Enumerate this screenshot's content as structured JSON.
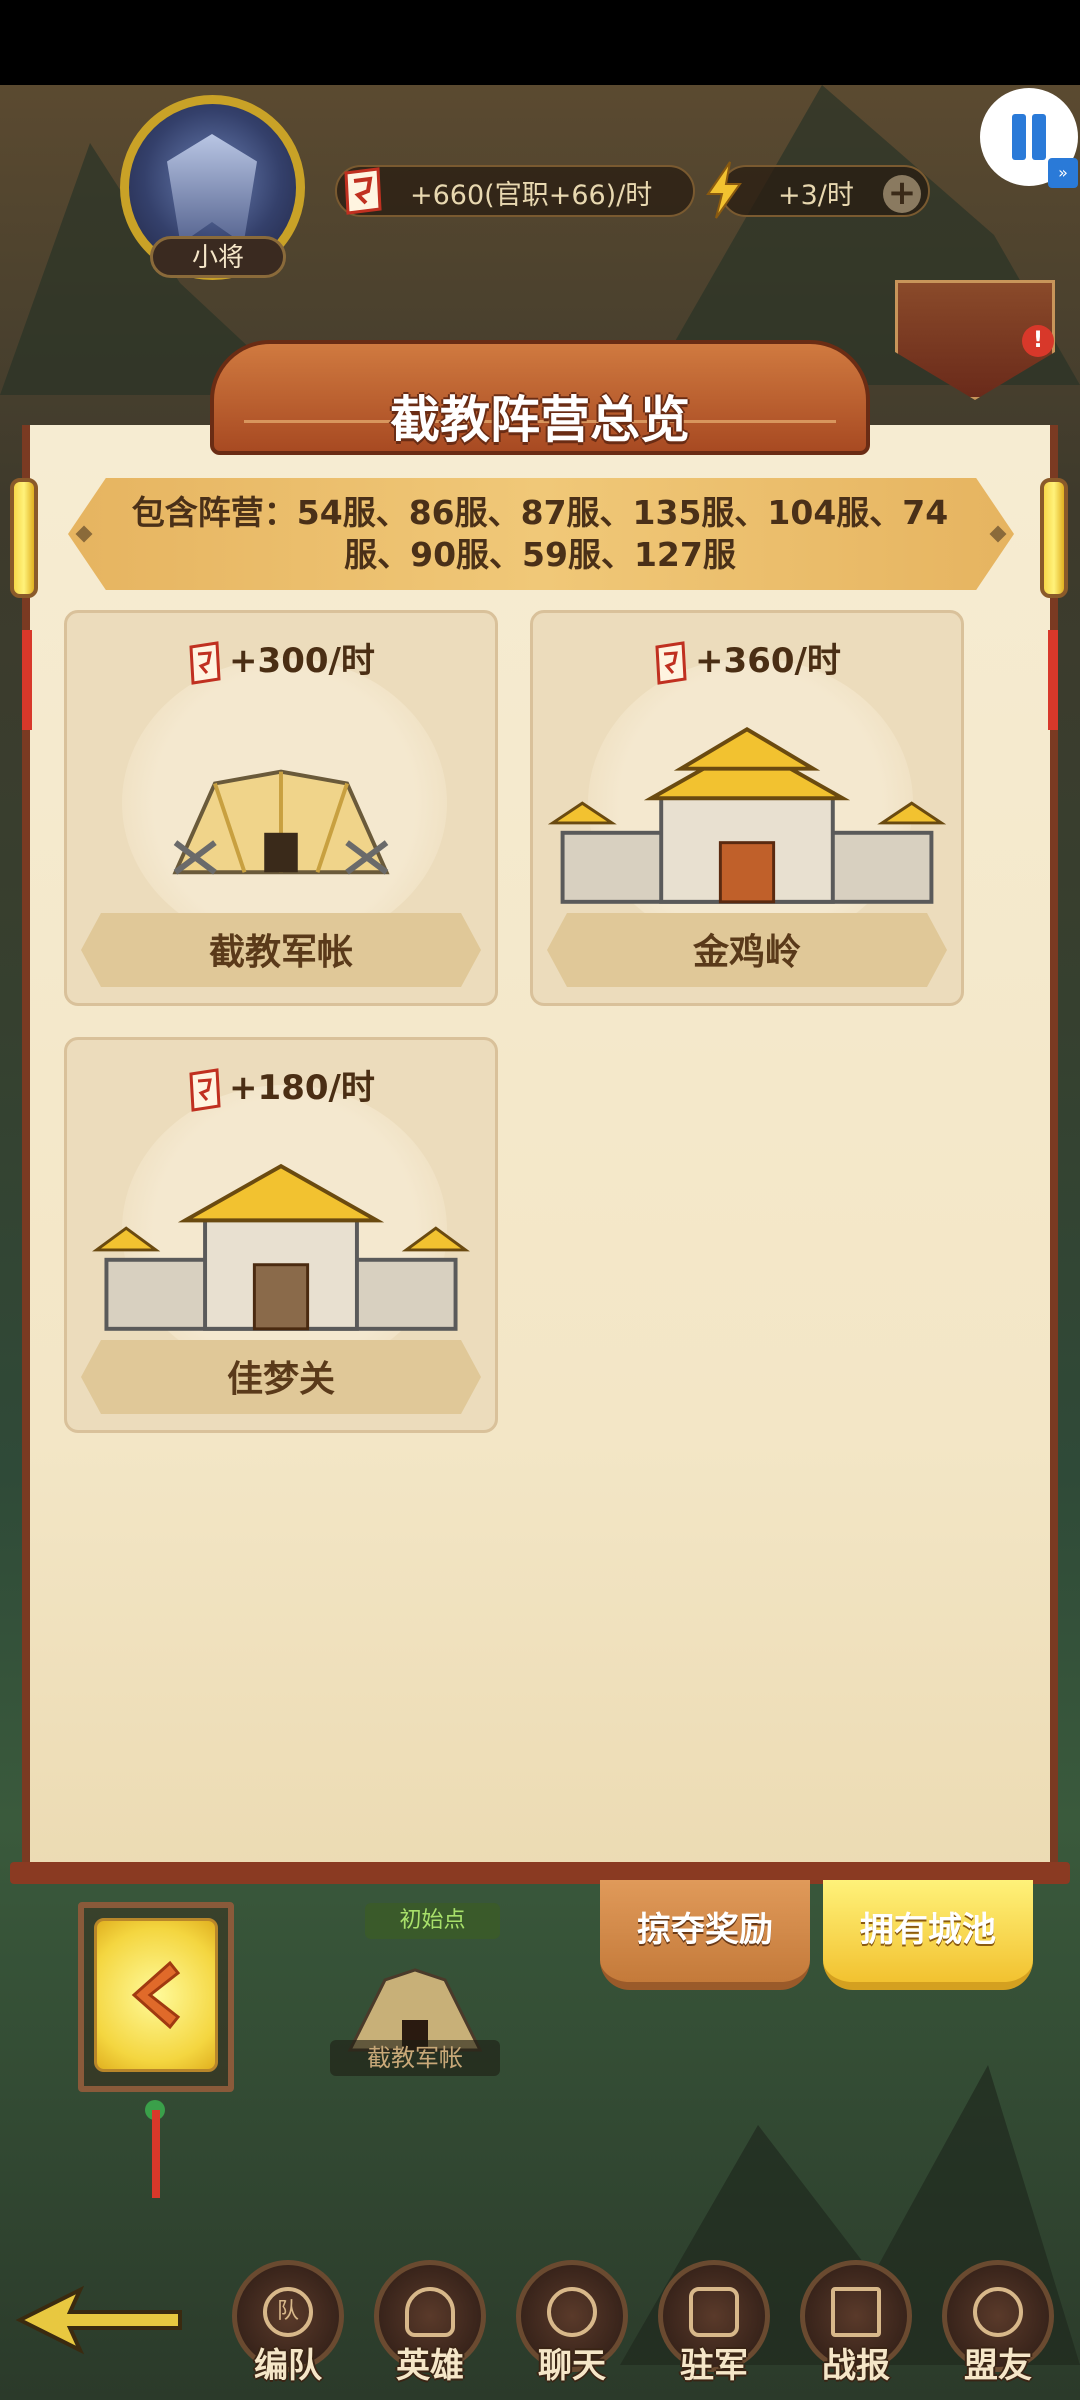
{
  "header": {
    "rank_label": "小将",
    "resource_text": "+660(官职+66)/时",
    "energy_text": "+3/时",
    "plus_icon": "plus-icon",
    "ad_icon": "fast-forward-icon"
  },
  "panel": {
    "title": "截教阵营总览",
    "camps_text": "包含阵营：54服、86服、87服、135服、104服、74服、90服、59服、127服"
  },
  "cities": [
    {
      "production": "+300/时",
      "name": "截教军帐",
      "icon": "military-tent-icon"
    },
    {
      "production": "+360/时",
      "name": "金鸡岭",
      "icon": "fortress-icon"
    },
    {
      "production": "+180/时",
      "name": "佳梦关",
      "icon": "fortress-icon"
    }
  ],
  "tabs": {
    "plunder": "掠夺奖励",
    "cities": "拥有城池"
  },
  "map": {
    "start_label": "初始点",
    "camp_label": "截教军帐"
  },
  "bottom_nav": [
    {
      "label": "编队",
      "icon": "formation-icon",
      "icon_text": "队"
    },
    {
      "label": "英雄",
      "icon": "hero-icon"
    },
    {
      "label": "聊天",
      "icon": "chat-icon"
    },
    {
      "label": "驻军",
      "icon": "garrison-icon"
    },
    {
      "label": "战报",
      "icon": "battle-report-icon"
    },
    {
      "label": "盟友",
      "icon": "alliance-icon"
    }
  ]
}
